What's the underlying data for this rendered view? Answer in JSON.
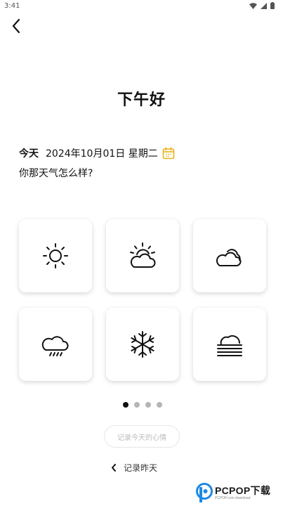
{
  "status_bar": {
    "time": "3:41"
  },
  "greeting": "下午好",
  "date": {
    "today_label": "今天",
    "value": "2024年10月01日 星期二"
  },
  "question": "你那天气怎么样?",
  "weather_options": [
    {
      "icon": "sun-icon"
    },
    {
      "icon": "partly-sunny-icon"
    },
    {
      "icon": "cloudy-icon"
    },
    {
      "icon": "rain-icon"
    },
    {
      "icon": "snow-icon"
    },
    {
      "icon": "fog-icon"
    }
  ],
  "pager": {
    "pages": 4,
    "current": 1
  },
  "actions": {
    "record_today": "记录今天的心情",
    "record_yesterday": "记录昨天"
  },
  "watermark": {
    "brand": "PCPOP下载",
    "sub": "PCPOP.com download"
  },
  "colors": {
    "accent_calendar": "#e8b21a",
    "watermark_blue": "#1e88e5"
  }
}
